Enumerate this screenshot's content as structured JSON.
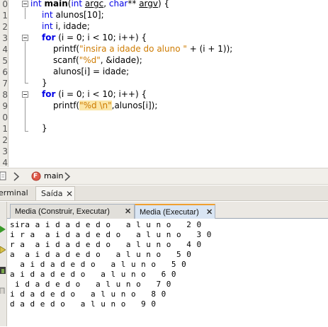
{
  "editor": {
    "line_numbers": [
      "0",
      "1",
      "2",
      "3",
      "4",
      "5",
      "6",
      "7",
      "8",
      "9",
      "0",
      "1",
      "2",
      "3",
      "4"
    ],
    "code": {
      "l0_kw": "int",
      "l0_fn": "main",
      "l0_p1": "(",
      "l0_kw2": "int",
      "l0_argc": "argc",
      "l0_p2": ", ",
      "l0_kw3": "char",
      "l0_p3": "** ",
      "l0_argv": "argv",
      "l0_p4": ") {",
      "l1_kw": "int",
      "l1_rest": " alunos[10];",
      "l2_kw": "int",
      "l2_rest": " i, idade;",
      "l3_kw": "for",
      "l3_rest": " (i = 0; i < 10; i++) {",
      "l4_pre": "printf(",
      "l4_str": "\"insira a idade do aluno \"",
      "l4_post": " + (i + 1));",
      "l5_pre": "scanf(",
      "l5_str": "\"%d\"",
      "l5_post": ", &idade);",
      "l6": "alunos[i] = idade;",
      "l7": "}",
      "l8_kw": "for",
      "l8_rest": " (i = 0; i < 10; i++) {",
      "l9_pre": "printf(",
      "l9_str": "\"%d \\n\"",
      "l9_post": ",alunos[i]);",
      "l11": "}"
    }
  },
  "breadcrumb": {
    "function_badge": "F",
    "function_name": "main"
  },
  "output_tabs": {
    "terminal_label": "erminal",
    "saida_label": "Saída",
    "close_glyph": "✕"
  },
  "sub_tabs": {
    "build_label": "Media (Construir, Executar)",
    "run_label": "Media (Executar)",
    "close_glyph": "✕"
  },
  "console": {
    "lines": [
      "sira a i d a d e d o   a l u n o   2 0",
      "i r a  a i d a d e d o   a l u n o   3 0",
      "r a  a i d a d e d o   a l u n o   4 0",
      "a  a i d a d e d o   a l u n o   5 0",
      "  a i d a d e d o   a l u n o   5 0",
      "a i d a d e d o   a l u n o   6 0",
      " i d a d e d o   a l u n o   7 0",
      "i d a d e d o   a l u n o   8 0",
      "d a d e d o   a l u n o   9 0"
    ]
  },
  "colors": {
    "keyword": "#0000e6",
    "string": "#ce7b00",
    "highlight": "#fbe6a8",
    "run_icon": "#3a9a2a",
    "function_badge": "#e05a4a",
    "active_tab_accent": "#f0a030"
  },
  "icons": {
    "editor": [
      "fold-toggle-icon"
    ],
    "breadcrumb": [
      "file-icon",
      "nav-arrow-icon",
      "function-icon",
      "chevron-right-icon"
    ],
    "leftbar": [
      "run-icon",
      "rerun-icon",
      "stop-icon",
      "settings-icon"
    ]
  }
}
